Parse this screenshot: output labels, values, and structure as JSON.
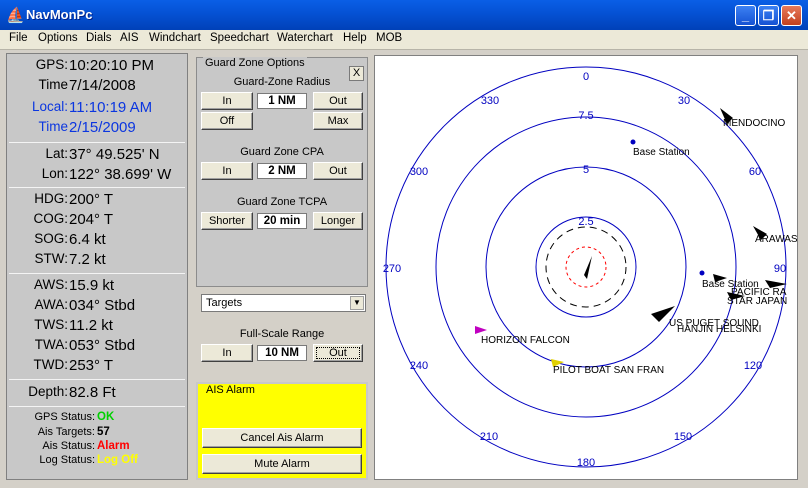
{
  "window": {
    "title": "NavMonPc",
    "app_icon": "sailboat-icon",
    "minimize_icon": "minimize-icon",
    "maximize_icon": "maximize-icon",
    "close_icon": "close-icon"
  },
  "menu": [
    "File",
    "Options",
    "Dials",
    "AIS",
    "Windchart",
    "Speedchart",
    "Waterchart",
    "Help",
    "MOB"
  ],
  "left": {
    "gps_label": "GPS:",
    "gps_value": "10:20:10 PM",
    "time_label": "Time",
    "time_value": "7/14/2008",
    "local_label": "Local:",
    "local_value": "11:10:19 AM",
    "time2_label": "Time",
    "time2_value": "2/15/2009",
    "lat_label": "Lat:",
    "lat_value": "37° 49.525' N",
    "lon_label": "Lon:",
    "lon_value": "122° 38.699' W",
    "hdg_label": "HDG:",
    "hdg_value": "200° T",
    "cog_label": "COG:",
    "cog_value": "204° T",
    "sog_label": "SOG:",
    "sog_value": "6.4 kt",
    "stw_label": "STW:",
    "stw_value": "7.2 kt",
    "aws_label": "AWS:",
    "aws_value": "15.9 kt",
    "awa_label": "AWA:",
    "awa_value": "034° Stbd",
    "tws_label": "TWS:",
    "tws_value": "11.2 kt",
    "twa_label": "TWA:",
    "twa_value": "053° Stbd",
    "twd_label": "TWD:",
    "twd_value": "253° T",
    "depth_label": "Depth:",
    "depth_value": "82.8 Ft",
    "gps_status_label": "GPS Status:",
    "gps_status_value": "OK",
    "gps_status_color": "#00d000",
    "ais_targets_label": "Ais Targets:",
    "ais_targets_value": "57",
    "ais_status_label": "Ais Status:",
    "ais_status_value": "Alarm",
    "ais_status_color": "#ff0000",
    "log_status_label": "Log Status:",
    "log_status_value": "Log Off",
    "log_status_color": "#ffff00"
  },
  "guard": {
    "title": "Guard Zone Options",
    "close": "X",
    "radius_title": "Guard-Zone Radius",
    "radius_in": "In",
    "radius_value": "1 NM",
    "radius_out": "Out",
    "off": "Off",
    "max": "Max",
    "cpa_title": "Guard Zone CPA",
    "cpa_in": "In",
    "cpa_value": "2 NM",
    "cpa_out": "Out",
    "tcpa_title": "Guard Zone TCPA",
    "tcpa_shorter": "Shorter",
    "tcpa_value": "20 min",
    "tcpa_longer": "Longer"
  },
  "targets_select": "Targets",
  "range": {
    "title": "Full-Scale Range",
    "in": "In",
    "value": "10 NM",
    "out": "Out"
  },
  "ais_alarm": {
    "title": "AIS Alarm",
    "cancel": "Cancel Ais Alarm",
    "mute": "Mute Alarm",
    "color": "#ffff00"
  },
  "radar": {
    "ring_labels": [
      "2.5",
      "5",
      "7.5"
    ],
    "bearings": [
      "0",
      "30",
      "60",
      "90",
      "120",
      "150",
      "180",
      "210",
      "240",
      "270",
      "300",
      "330"
    ],
    "targets": [
      "MENDOCINO",
      "Base Station",
      "ARAWASHI",
      "Base Station",
      "PACIFIC RA",
      "STAR JAPAN",
      "US PUGET SOUND",
      "HANJIN HELSINKI",
      "HORIZON FALCON",
      "PILOT BOAT SAN FRAN"
    ],
    "ring_color": "#0000c0",
    "guard_color": "#ff0000"
  }
}
